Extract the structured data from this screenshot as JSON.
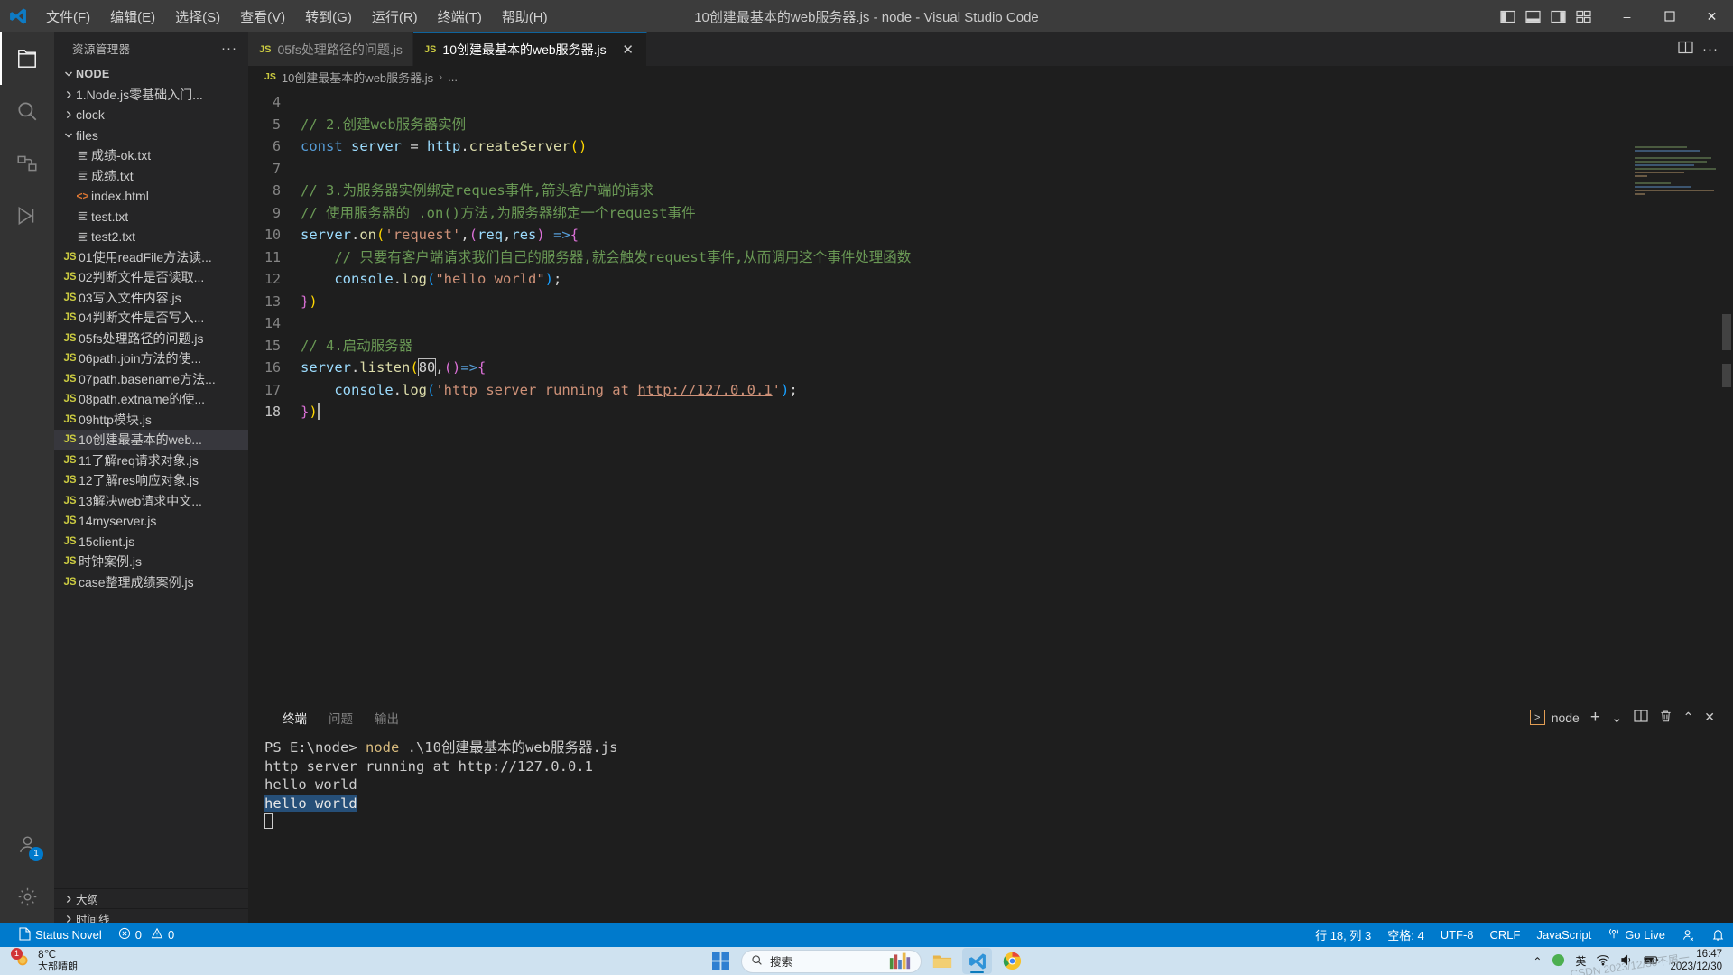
{
  "titlebar": {
    "title": "10创建最基本的web服务器.js - node - Visual Studio Code",
    "menu": [
      {
        "label": "文件(F)"
      },
      {
        "label": "编辑(E)"
      },
      {
        "label": "选择(S)"
      },
      {
        "label": "查看(V)"
      },
      {
        "label": "转到(G)"
      },
      {
        "label": "运行(R)"
      },
      {
        "label": "终端(T)"
      },
      {
        "label": "帮助(H)"
      }
    ],
    "window_buttons": {
      "minimize": "–",
      "maximize": "☐",
      "close": "✕"
    }
  },
  "activitybar": {
    "items": [
      {
        "name": "explorer",
        "active": true
      },
      {
        "name": "search",
        "active": false
      },
      {
        "name": "source-control",
        "active": false
      },
      {
        "name": "run-debug",
        "active": false
      }
    ],
    "bottom": [
      {
        "name": "accounts",
        "badge": "1"
      },
      {
        "name": "settings",
        "badge": ""
      }
    ]
  },
  "sidebar": {
    "header": "资源管理器",
    "more_label": "···",
    "root": "NODE",
    "tree": [
      {
        "label": "1.Node.js零基础入门...",
        "type": "folder",
        "expanded": false,
        "indent": 1
      },
      {
        "label": "clock",
        "type": "folder",
        "expanded": false,
        "indent": 1
      },
      {
        "label": "files",
        "type": "folder",
        "expanded": true,
        "indent": 1
      },
      {
        "label": "成绩-ok.txt",
        "type": "txt",
        "indent": 2
      },
      {
        "label": "成绩.txt",
        "type": "txt",
        "indent": 2
      },
      {
        "label": "index.html",
        "type": "html",
        "indent": 2
      },
      {
        "label": "test.txt",
        "type": "txt",
        "indent": 2
      },
      {
        "label": "test2.txt",
        "type": "txt",
        "indent": 2
      },
      {
        "label": "01使用readFile方法读...",
        "type": "js",
        "indent": 1
      },
      {
        "label": "02判断文件是否读取...",
        "type": "js",
        "indent": 1
      },
      {
        "label": "03写入文件内容.js",
        "type": "js",
        "indent": 1
      },
      {
        "label": "04判断文件是否写入...",
        "type": "js",
        "indent": 1
      },
      {
        "label": "05fs处理路径的问题.js",
        "type": "js",
        "indent": 1
      },
      {
        "label": "06path.join方法的使...",
        "type": "js",
        "indent": 1
      },
      {
        "label": "07path.basename方法...",
        "type": "js",
        "indent": 1
      },
      {
        "label": "08path.extname的使...",
        "type": "js",
        "indent": 1
      },
      {
        "label": "09http模块.js",
        "type": "js",
        "indent": 1
      },
      {
        "label": "10创建最基本的web...",
        "type": "js",
        "indent": 1,
        "selected": true
      },
      {
        "label": "11了解req请求对象.js",
        "type": "js",
        "indent": 1
      },
      {
        "label": "12了解res响应对象.js",
        "type": "js",
        "indent": 1
      },
      {
        "label": "13解决web请求中文...",
        "type": "js",
        "indent": 1
      },
      {
        "label": "14myserver.js",
        "type": "js",
        "indent": 1
      },
      {
        "label": "15client.js",
        "type": "js",
        "indent": 1
      },
      {
        "label": "时钟案例.js",
        "type": "js",
        "indent": 1
      },
      {
        "label": "case整理成绩案例.js",
        "type": "js",
        "indent": 1
      }
    ],
    "sections": [
      {
        "label": "大纲"
      },
      {
        "label": "时间线"
      }
    ]
  },
  "editor": {
    "tabs": [
      {
        "label": "05fs处理路径的问题.js",
        "icon": "JS",
        "active": false,
        "close": "✕"
      },
      {
        "label": "10创建最基本的web服务器.js",
        "icon": "JS",
        "active": true,
        "close": "✕"
      }
    ],
    "breadcrumb": {
      "icon": "JS",
      "file": "10创建最基本的web服务器.js",
      "sep": "›",
      "more": "..."
    },
    "code_lines": [
      {
        "num": "4",
        "segments": []
      },
      {
        "num": "5",
        "segments": [
          {
            "t": "// 2.创建web服务器实例",
            "c": "cmt"
          }
        ]
      },
      {
        "num": "6",
        "segments": [
          {
            "t": "const ",
            "c": "kw"
          },
          {
            "t": "server ",
            "c": "var"
          },
          {
            "t": "= ",
            "c": "op"
          },
          {
            "t": "http",
            "c": "var"
          },
          {
            "t": ".",
            "c": "op"
          },
          {
            "t": "createServer",
            "c": "fn"
          },
          {
            "t": "()",
            "c": "par1"
          }
        ]
      },
      {
        "num": "7",
        "segments": []
      },
      {
        "num": "8",
        "segments": [
          {
            "t": "// 3.为服务器实例绑定reques事件,箭头客户端的请求",
            "c": "cmt"
          }
        ]
      },
      {
        "num": "9",
        "segments": [
          {
            "t": "// 使用服务器的 .on()方法,为服务器绑定一个request事件",
            "c": "cmt"
          }
        ]
      },
      {
        "num": "10",
        "segments": [
          {
            "t": "server",
            "c": "var"
          },
          {
            "t": ".",
            "c": "op"
          },
          {
            "t": "on",
            "c": "fn"
          },
          {
            "t": "(",
            "c": "par1"
          },
          {
            "t": "'request'",
            "c": "str"
          },
          {
            "t": ",",
            "c": "op"
          },
          {
            "t": "(",
            "c": "par2"
          },
          {
            "t": "req",
            "c": "var"
          },
          {
            "t": ",",
            "c": "op"
          },
          {
            "t": "res",
            "c": "var"
          },
          {
            "t": ")",
            "c": "par2"
          },
          {
            "t": " =>",
            "c": "kw"
          },
          {
            "t": "{",
            "c": "par2"
          }
        ]
      },
      {
        "num": "11",
        "segments": [
          {
            "t": "    // 只要有客户端请求我们自己的服务器,就会触发request事件,从而调用这个事件处理函数",
            "c": "cmt"
          }
        ]
      },
      {
        "num": "12",
        "segments": [
          {
            "t": "    console",
            "c": "var"
          },
          {
            "t": ".",
            "c": "op"
          },
          {
            "t": "log",
            "c": "fn"
          },
          {
            "t": "(",
            "c": "par3"
          },
          {
            "t": "\"hello world\"",
            "c": "str"
          },
          {
            "t": ")",
            "c": "par3"
          },
          {
            "t": ";",
            "c": "op"
          }
        ]
      },
      {
        "num": "13",
        "segments": [
          {
            "t": "}",
            "c": "par2"
          },
          {
            "t": ")",
            "c": "par1"
          }
        ]
      },
      {
        "num": "14",
        "segments": []
      },
      {
        "num": "15",
        "segments": [
          {
            "t": "// 4.启动服务器",
            "c": "cmt"
          }
        ]
      },
      {
        "num": "16",
        "segments": [
          {
            "t": "server",
            "c": "var"
          },
          {
            "t": ".",
            "c": "op"
          },
          {
            "t": "listen",
            "c": "fn"
          },
          {
            "t": "(",
            "c": "par1"
          },
          {
            "t": "80",
            "c": "num"
          },
          {
            "t": ",",
            "c": "op"
          },
          {
            "t": "()",
            "c": "par2"
          },
          {
            "t": "=>",
            "c": "kw"
          },
          {
            "t": "{",
            "c": "par2"
          }
        ]
      },
      {
        "num": "17",
        "segments": [
          {
            "t": "    console",
            "c": "var"
          },
          {
            "t": ".",
            "c": "op"
          },
          {
            "t": "log",
            "c": "fn"
          },
          {
            "t": "(",
            "c": "par3"
          },
          {
            "t": "'http server running at ",
            "c": "str"
          },
          {
            "t": "http://127.0.0.1",
            "c": "link"
          },
          {
            "t": "'",
            "c": "str"
          },
          {
            "t": ")",
            "c": "par3"
          },
          {
            "t": ";",
            "c": "op"
          }
        ]
      },
      {
        "num": "18",
        "segments": [
          {
            "t": "}",
            "c": "par2"
          },
          {
            "t": ")",
            "c": "par1"
          }
        ],
        "current": true
      }
    ]
  },
  "panel": {
    "tabs": [
      {
        "label": "终端",
        "active": true
      },
      {
        "label": "问题",
        "active": false
      },
      {
        "label": "输出",
        "active": false
      }
    ],
    "terminal_name": "node",
    "actions": {
      "new": "+",
      "dropdown": "⌄",
      "split": "split-icon",
      "kill": "trash-icon",
      "maximize": "⌃",
      "close": "✕"
    },
    "terminal_lines": [
      {
        "parts": [
          {
            "t": "PS E:\\node> ",
            "c": "t-ps"
          },
          {
            "t": "node",
            "c": "t-cmd"
          },
          {
            "t": " .\\10创建最基本的web服务器.js",
            "c": "t-ps"
          }
        ]
      },
      {
        "parts": [
          {
            "t": "http server running at http://127.0.0.1",
            "c": "t-ps"
          }
        ]
      },
      {
        "parts": [
          {
            "t": "hello world",
            "c": "t-ps"
          }
        ]
      },
      {
        "parts": [
          {
            "t": "hello world",
            "c": "t-sel"
          }
        ]
      }
    ]
  },
  "statusbar": {
    "left": [
      {
        "name": "status-novel",
        "label": "Status Novel",
        "icon": "file-icon"
      },
      {
        "name": "problems",
        "label": "0",
        "icon": "error-icon",
        "label2": "0",
        "icon2": "warning-icon"
      }
    ],
    "right": [
      {
        "name": "cursor-position",
        "label": "行 18, 列 3"
      },
      {
        "name": "indentation",
        "label": "空格: 4"
      },
      {
        "name": "encoding",
        "label": "UTF-8"
      },
      {
        "name": "eol",
        "label": "CRLF"
      },
      {
        "name": "language-mode",
        "label": "JavaScript"
      },
      {
        "name": "go-live",
        "label": "Go Live",
        "icon": "broadcast-icon"
      },
      {
        "name": "remote",
        "label": "",
        "icon": "account-icon"
      },
      {
        "name": "notifications",
        "label": "",
        "icon": "bell-icon"
      }
    ]
  },
  "taskbar": {
    "weather_temp": "8℃",
    "weather_desc": "大部晴朗",
    "weather_badge": "1",
    "search_placeholder": "搜索",
    "apps": [
      {
        "name": "start",
        "active": false
      },
      {
        "name": "file-explorer",
        "active": false
      },
      {
        "name": "vscode",
        "active": true
      },
      {
        "name": "chrome",
        "active": false
      }
    ],
    "tray": [
      "⌃",
      "wechat-icon",
      "英",
      "wifi-icon",
      "volume-icon",
      "battery-icon"
    ],
    "clock_time": "16:47",
    "clock_date": "2023/12/30",
    "watermark": "CSDN 2023/12/30不屑一"
  },
  "colors": {
    "accent": "#007acc",
    "titlebar_bg": "#3c3c3c",
    "sidebar_bg": "#252526",
    "editor_bg": "#1e1e1e",
    "activitybar_bg": "#333333",
    "taskbar_bg": "#cfe2f0",
    "js_yellow": "#cbcb41",
    "comment_green": "#6a9955",
    "string_orange": "#ce9178",
    "keyword_blue": "#569cd6"
  }
}
